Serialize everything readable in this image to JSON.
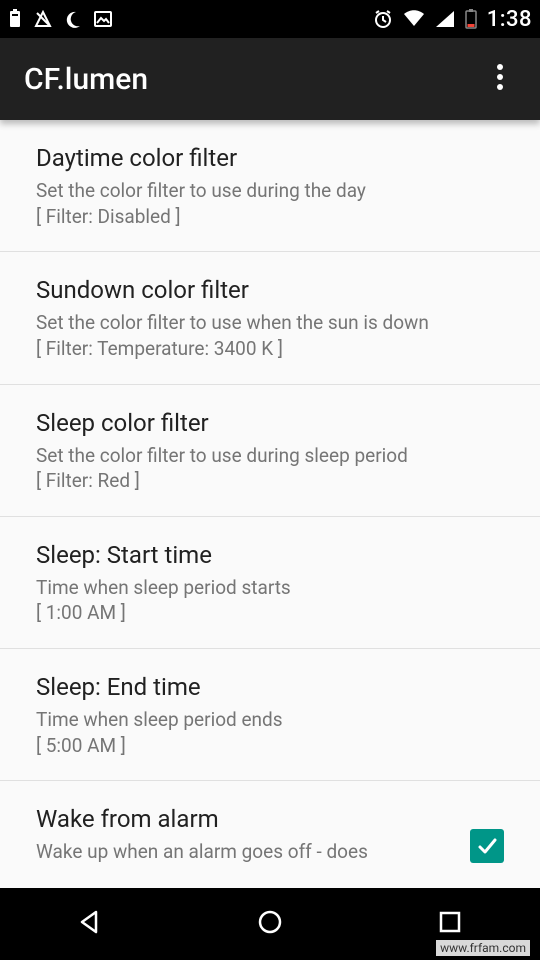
{
  "status": {
    "time": "1:38"
  },
  "appbar": {
    "title": "CF.lumen"
  },
  "rows": [
    {
      "title": "Daytime color filter",
      "subtitle": "Set the color filter to use during the day\n[ Filter: Disabled ]"
    },
    {
      "title": "Sundown color filter",
      "subtitle": "Set the color filter to use when the sun is down\n[ Filter: Temperature: 3400 K ]"
    },
    {
      "title": "Sleep color filter",
      "subtitle": "Set the color filter to use during sleep period\n[ Filter: Red ]"
    },
    {
      "title": "Sleep: Start time",
      "subtitle": "Time when sleep period starts\n[ 1:00 AM ]"
    },
    {
      "title": "Sleep: End time",
      "subtitle": "Time when sleep period ends\n[ 5:00 AM ]"
    },
    {
      "title": "Wake from alarm",
      "subtitle": "Wake up when an alarm goes off - does",
      "checked": true
    }
  ],
  "watermark": "www.frfam.com"
}
